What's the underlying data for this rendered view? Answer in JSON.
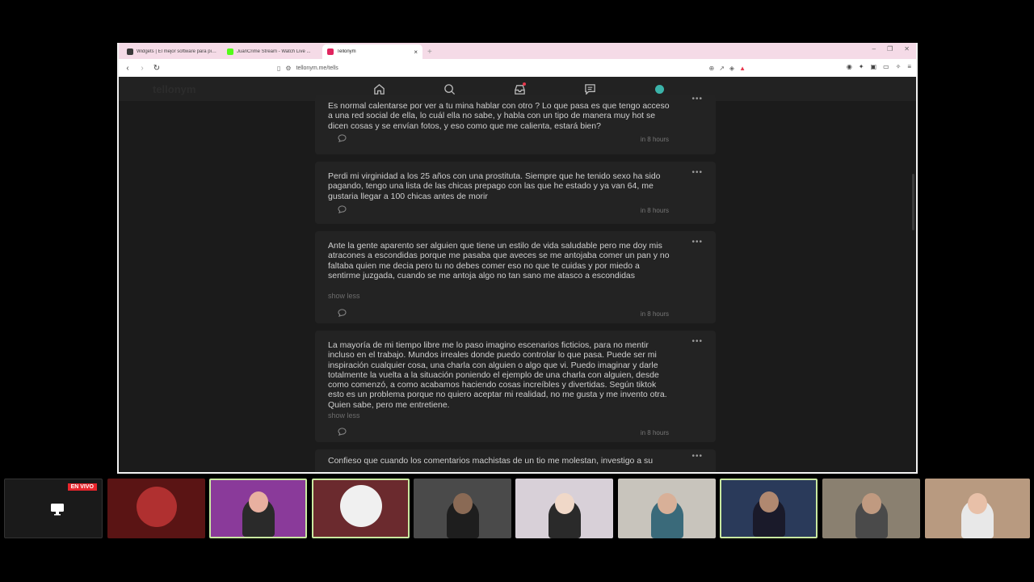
{
  "browser": {
    "tabs": [
      {
        "title": "Widgets | El mejor software para pintar...",
        "active": false,
        "color": "#3a3a3a"
      },
      {
        "title": "JuanCrime Stream - Watch Live ...",
        "active": false,
        "color": "#53fc18"
      },
      {
        "title": "Tellonym",
        "active": true,
        "color": "#e0245e"
      }
    ],
    "url": "tellonym.me/tells"
  },
  "app": {
    "logo": "tellonym",
    "accent": "#e8364c",
    "avatar_color": "#3bb3a9"
  },
  "tells": [
    {
      "text": "Es normal calentarse por ver a tu mina hablar con otro ? Lo que pasa es que tengo acceso a una red social de ella, lo cuál ella no sabe, y habla con un tipo de manera muy hot se dicen cosas y se envían fotos, y eso como que me calienta, estará bien?",
      "time": "in 8 hours",
      "show_less": ""
    },
    {
      "text": "Perdi mi virginidad a los 25 años con una prostituta. Siempre que he tenido sexo ha sido pagando, tengo una lista de las chicas prepago con las que he estado y ya van 64, me gustaria llegar a 100 chicas antes de morir",
      "time": "in 8 hours",
      "show_less": ""
    },
    {
      "text": "Ante la gente aparento ser alguien que tiene un estilo de vida saludable pero me doy mis atracones a escondidas porque me pasaba que aveces se me antojaba comer un pan y no faltaba quien me decia pero tu no debes comer eso no que te cuidas y por miedo a sentirme juzgada, cuando se me antoja algo no tan sano me atasco a escondidas",
      "time": "in 8 hours",
      "show_less": "show less"
    },
    {
      "text": "La mayoría de mi tiempo libre me lo paso imagino escenarios ficticios, para no mentir incluso en el trabajo. Mundos irreales donde puedo controlar lo que pasa. Puede ser mi inspiración cualquier cosa, una charla con alguien o algo que vi. Puedo imaginar y darle totalmente la vuelta a la situación poniendo el ejemplo de una charla con alguien, desde como comenzó, a como acabamos haciendo cosas increíbles y divertidas. Según tiktok esto es un problema porque no quiero aceptar mi realidad, no me gusta y me invento otra. Quien sabe, pero me entretiene.",
      "time": "in 8 hours",
      "show_less": "show less"
    },
    {
      "text": "Confieso que cuando los comentarios machistas de un tio me molestan, investigo a su",
      "time": "",
      "show_less": ""
    }
  ],
  "stream": {
    "live_label": "EN VIVO",
    "cams": [
      {
        "bg": "#1a1a1a",
        "skin": "#333"
      },
      {
        "bg": "#5a1414",
        "skin": "#b03030"
      },
      {
        "bg": "#8a3a9a",
        "skin": "#e8b0a0"
      },
      {
        "bg": "#6b2a2e",
        "skin": "#f0f0f0"
      },
      {
        "bg": "#4a4a4a",
        "skin": "#8a6a55"
      },
      {
        "bg": "#d8d0d8",
        "skin": "#f0d8c8"
      },
      {
        "bg": "#c8c4bc",
        "skin": "#d8b098"
      },
      {
        "bg": "#2a3a5a",
        "skin": "#b08870"
      },
      {
        "bg": "#8a8070",
        "skin": "#c09a80"
      },
      {
        "bg": "#b89a80",
        "skin": "#e8c0a8"
      }
    ]
  }
}
